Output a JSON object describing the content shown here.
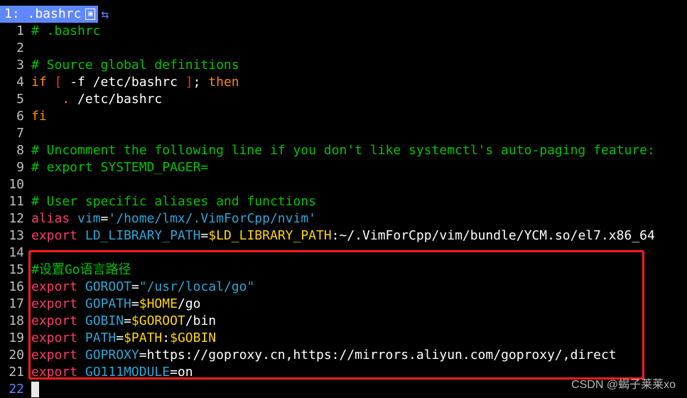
{
  "tab": {
    "label": "1: .bashrc",
    "modified_marker": "▣",
    "switch_icon": "⇆"
  },
  "lines": [
    {
      "n": "1",
      "tokens": [
        {
          "c": "comment",
          "t": "# .bashrc"
        }
      ]
    },
    {
      "n": "2",
      "tokens": []
    },
    {
      "n": "3",
      "tokens": [
        {
          "c": "comment",
          "t": "# Source global definitions"
        }
      ]
    },
    {
      "n": "4",
      "tokens": [
        {
          "c": "keyword",
          "t": "if"
        },
        {
          "c": "plain",
          "t": " "
        },
        {
          "c": "bracket",
          "t": "["
        },
        {
          "c": "plain",
          "t": " -f /etc/bashrc "
        },
        {
          "c": "bracket",
          "t": "]"
        },
        {
          "c": "plain",
          "t": "; "
        },
        {
          "c": "keyword",
          "t": "then"
        }
      ]
    },
    {
      "n": "5",
      "tokens": [
        {
          "c": "plain",
          "t": "    "
        },
        {
          "c": "dot",
          "t": "."
        },
        {
          "c": "plain",
          "t": " /etc/bashrc"
        }
      ]
    },
    {
      "n": "6",
      "tokens": [
        {
          "c": "keyword",
          "t": "fi"
        }
      ]
    },
    {
      "n": "7",
      "tokens": []
    },
    {
      "n": "8",
      "tokens": [
        {
          "c": "comment",
          "t": "# Uncomment the following line if you don't like systemctl's auto-paging feature:"
        }
      ]
    },
    {
      "n": "9",
      "tokens": [
        {
          "c": "comment",
          "t": "# export SYSTEMD_PAGER="
        }
      ]
    },
    {
      "n": "10",
      "tokens": []
    },
    {
      "n": "11",
      "tokens": [
        {
          "c": "comment",
          "t": "# User specific aliases and functions"
        }
      ]
    },
    {
      "n": "12",
      "tokens": [
        {
          "c": "export",
          "t": "alias"
        },
        {
          "c": "plain",
          "t": " "
        },
        {
          "c": "var",
          "t": "vim"
        },
        {
          "c": "plain",
          "t": "="
        },
        {
          "c": "var",
          "t": "'/home/lmx/.VimForCpp/nvim'"
        }
      ]
    },
    {
      "n": "13",
      "tokens": [
        {
          "c": "export",
          "t": "export"
        },
        {
          "c": "plain",
          "t": " "
        },
        {
          "c": "var",
          "t": "LD_LIBRARY_PATH"
        },
        {
          "c": "plain",
          "t": "="
        },
        {
          "c": "dollar",
          "t": "$LD_LIBRARY_PATH"
        },
        {
          "c": "plain",
          "t": ":~/.VimForCpp/vim/bundle/YCM.so/el7.x86_64"
        }
      ]
    },
    {
      "n": "14",
      "tokens": []
    },
    {
      "n": "15",
      "tokens": [
        {
          "c": "comment",
          "t": "#设置Go语言路径"
        }
      ]
    },
    {
      "n": "16",
      "tokens": [
        {
          "c": "export",
          "t": "export"
        },
        {
          "c": "plain",
          "t": " "
        },
        {
          "c": "var",
          "t": "GOROOT"
        },
        {
          "c": "plain",
          "t": "="
        },
        {
          "c": "var",
          "t": "\"/usr/local/go\""
        }
      ]
    },
    {
      "n": "17",
      "tokens": [
        {
          "c": "export",
          "t": "export"
        },
        {
          "c": "plain",
          "t": " "
        },
        {
          "c": "var",
          "t": "GOPATH"
        },
        {
          "c": "plain",
          "t": "="
        },
        {
          "c": "dollar",
          "t": "$HOME"
        },
        {
          "c": "plain",
          "t": "/go"
        }
      ]
    },
    {
      "n": "18",
      "tokens": [
        {
          "c": "export",
          "t": "export"
        },
        {
          "c": "plain",
          "t": " "
        },
        {
          "c": "var",
          "t": "GOBIN"
        },
        {
          "c": "plain",
          "t": "="
        },
        {
          "c": "dollar",
          "t": "$GOROOT"
        },
        {
          "c": "plain",
          "t": "/bin"
        }
      ]
    },
    {
      "n": "19",
      "tokens": [
        {
          "c": "export",
          "t": "export"
        },
        {
          "c": "plain",
          "t": " "
        },
        {
          "c": "var",
          "t": "PATH"
        },
        {
          "c": "plain",
          "t": "="
        },
        {
          "c": "dollar",
          "t": "$PATH"
        },
        {
          "c": "plain",
          "t": ":"
        },
        {
          "c": "dollar",
          "t": "$GOBIN"
        }
      ]
    },
    {
      "n": "20",
      "tokens": [
        {
          "c": "export",
          "t": "export"
        },
        {
          "c": "plain",
          "t": " "
        },
        {
          "c": "var",
          "t": "GOPROXY"
        },
        {
          "c": "plain",
          "t": "=https://goproxy.cn,https://mirrors.aliyun.com/goproxy/,direct"
        }
      ]
    },
    {
      "n": "21",
      "tokens": [
        {
          "c": "export",
          "t": "export"
        },
        {
          "c": "plain",
          "t": " "
        },
        {
          "c": "var",
          "t": "GO111MODULE"
        },
        {
          "c": "plain",
          "t": "=on"
        }
      ]
    },
    {
      "n": "22",
      "tokens": [],
      "cursor": true,
      "current": true
    }
  ],
  "watermark": "CSDN @蝎子莱莱xo",
  "colors": {
    "tab_bg": "#5f87ff",
    "comment": "#00c400",
    "highlight_box": "#ff1e1e"
  }
}
